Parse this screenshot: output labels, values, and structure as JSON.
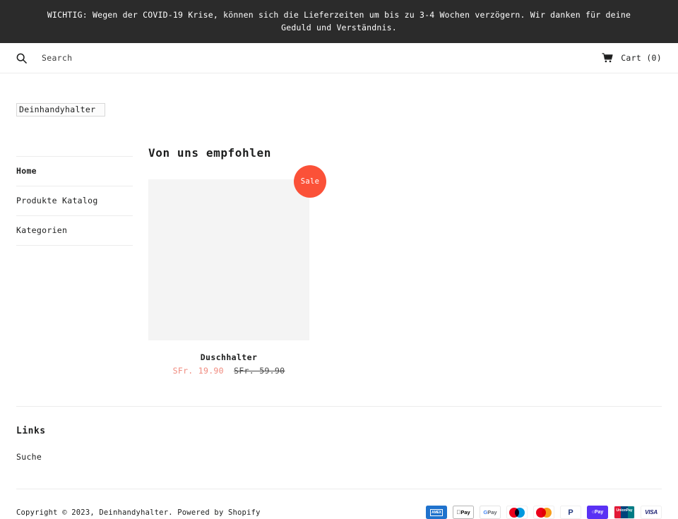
{
  "announcement": {
    "text": "WICHTIG: Wegen der COVID-19 Krise, können sich die Lieferzeiten um bis zu 3-4 Wochen verzögern. Wir danken für deine Geduld und Verständnis."
  },
  "header": {
    "search_icon": "search-icon",
    "search_placeholder": "Search",
    "cart_icon": "cart-icon",
    "cart_label": "Cart (0)"
  },
  "logo": {
    "alt_text": "Deinhandyhalter"
  },
  "sidebar": {
    "items": [
      {
        "label": "Home",
        "active": true
      },
      {
        "label": "Produkte Katalog",
        "active": false
      },
      {
        "label": "Kategorien",
        "active": false
      }
    ]
  },
  "main": {
    "section_title": "Von uns empfohlen",
    "products": [
      {
        "badge": "Sale",
        "title": "Duschhalter",
        "price_sale": "SFr. 19.90",
        "price_compare": "SFr. 59.90"
      }
    ]
  },
  "footer": {
    "links_title": "Links",
    "links": [
      {
        "label": "Suche"
      }
    ],
    "copyright": "Copyright © 2023, Deinhandyhalter. Powered by Shopify",
    "payment_icons": [
      {
        "name": "amex-icon",
        "label": "AMEX"
      },
      {
        "name": "apple-pay-icon",
        "label": "Pay"
      },
      {
        "name": "google-pay-icon",
        "label": "Pay"
      },
      {
        "name": "maestro-icon",
        "label": ""
      },
      {
        "name": "mastercard-icon",
        "label": ""
      },
      {
        "name": "paypal-icon",
        "label": "P"
      },
      {
        "name": "shop-pay-icon",
        "label": "Pay"
      },
      {
        "name": "unionpay-icon",
        "label": "UnionPay"
      },
      {
        "name": "visa-icon",
        "label": "VISA"
      }
    ]
  },
  "colors": {
    "announcement_bg": "#2b2b2b",
    "sale_badge": "#fb5138",
    "sale_price": "#f08a7e",
    "image_placeholder": "#f4f4f4",
    "divider": "#ececec"
  }
}
